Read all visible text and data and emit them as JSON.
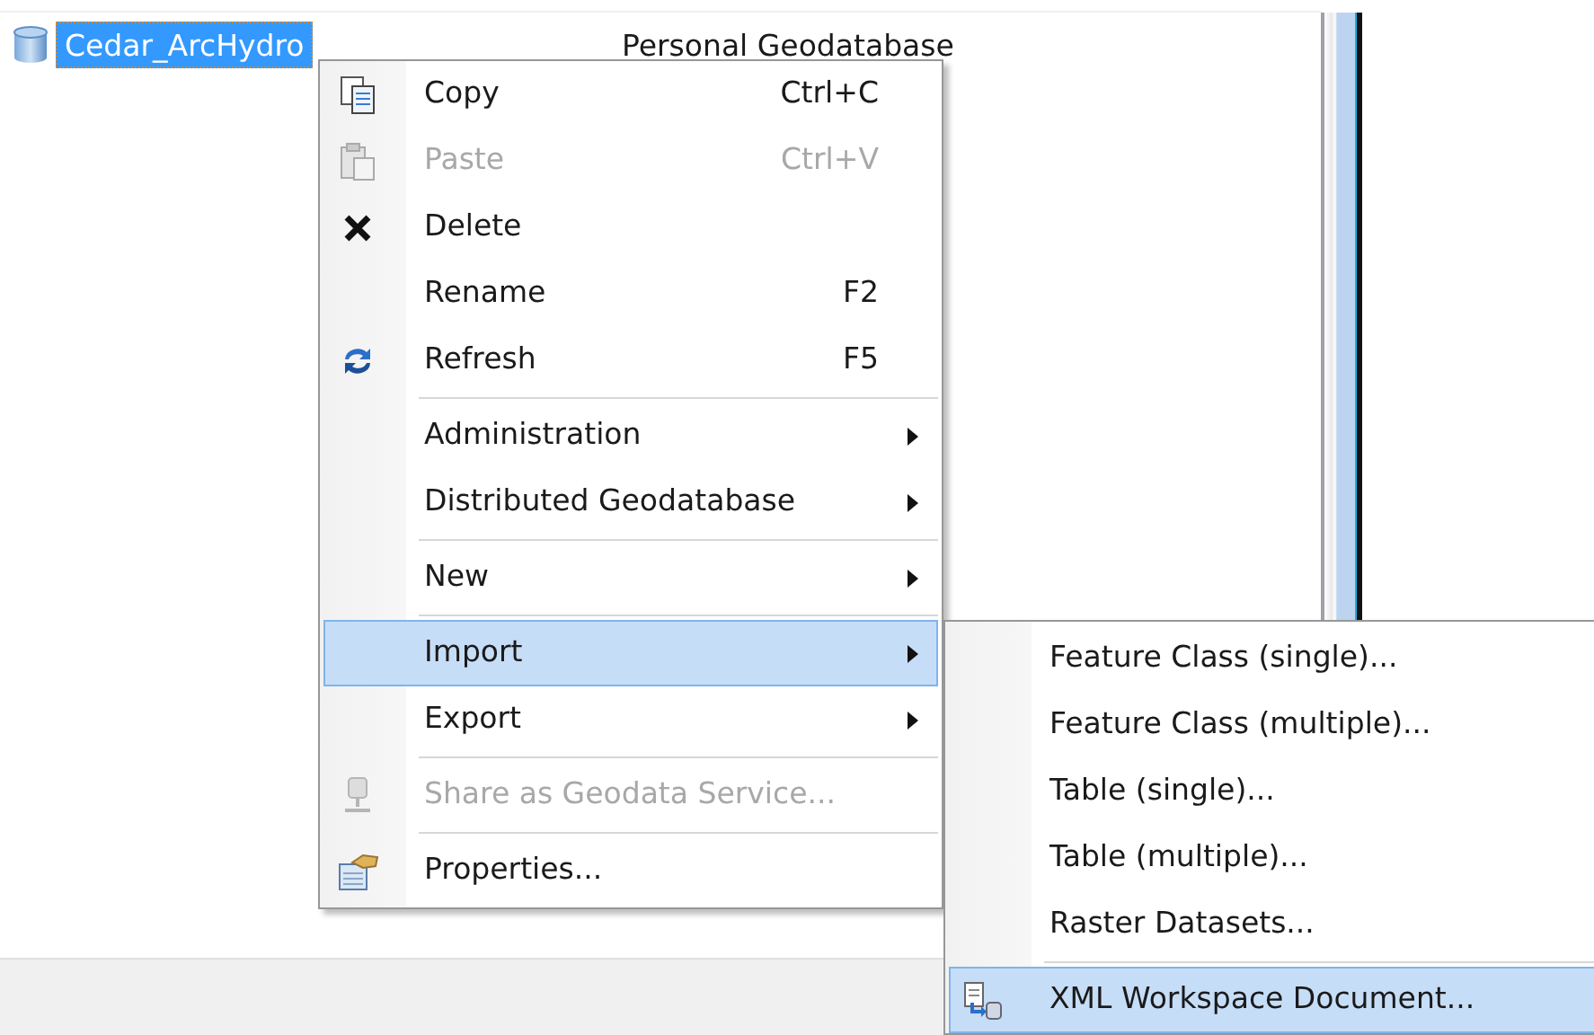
{
  "tree": {
    "items": [
      {
        "label": "Cedar_ArcHydro",
        "type_text": "Personal Geodatabase",
        "selected": true
      }
    ]
  },
  "context_menu": {
    "items": [
      {
        "kind": "item",
        "label": "Copy",
        "shortcut": "Ctrl+C",
        "disabled": false,
        "selected": false,
        "submenu": false
      },
      {
        "kind": "item",
        "label": "Paste",
        "shortcut": "Ctrl+V",
        "disabled": true,
        "selected": false,
        "submenu": false
      },
      {
        "kind": "item",
        "label": "Delete",
        "disabled": false,
        "selected": false,
        "submenu": false
      },
      {
        "kind": "item",
        "label": "Rename",
        "shortcut": "F2",
        "disabled": false,
        "selected": false,
        "submenu": false
      },
      {
        "kind": "item",
        "label": "Refresh",
        "shortcut": "F5",
        "disabled": false,
        "selected": false,
        "submenu": false
      },
      {
        "kind": "separator"
      },
      {
        "kind": "item",
        "label": "Administration",
        "disabled": false,
        "selected": false,
        "submenu": true
      },
      {
        "kind": "item",
        "label": "Distributed Geodatabase",
        "disabled": false,
        "selected": false,
        "submenu": true
      },
      {
        "kind": "separator"
      },
      {
        "kind": "item",
        "label": "New",
        "disabled": false,
        "selected": false,
        "submenu": true
      },
      {
        "kind": "separator"
      },
      {
        "kind": "item",
        "label": "Import",
        "disabled": false,
        "selected": true,
        "submenu": true
      },
      {
        "kind": "item",
        "label": "Export",
        "disabled": false,
        "selected": false,
        "submenu": true
      },
      {
        "kind": "separator"
      },
      {
        "kind": "item",
        "label": "Share as Geodata Service...",
        "disabled": true,
        "selected": false,
        "submenu": false
      },
      {
        "kind": "separator"
      },
      {
        "kind": "item",
        "label": "Properties...",
        "disabled": false,
        "selected": false,
        "submenu": false
      }
    ]
  },
  "submenu": {
    "items": [
      {
        "kind": "item",
        "label": "Feature Class (single)...",
        "selected": false
      },
      {
        "kind": "item",
        "label": "Feature Class (multiple)...",
        "selected": false
      },
      {
        "kind": "item",
        "label": "Table (single)...",
        "selected": false
      },
      {
        "kind": "item",
        "label": "Table (multiple)...",
        "selected": false
      },
      {
        "kind": "item",
        "label": "Raster Datasets...",
        "selected": false
      },
      {
        "kind": "separator"
      },
      {
        "kind": "item",
        "label": "XML Workspace Document...",
        "selected": true
      }
    ]
  }
}
